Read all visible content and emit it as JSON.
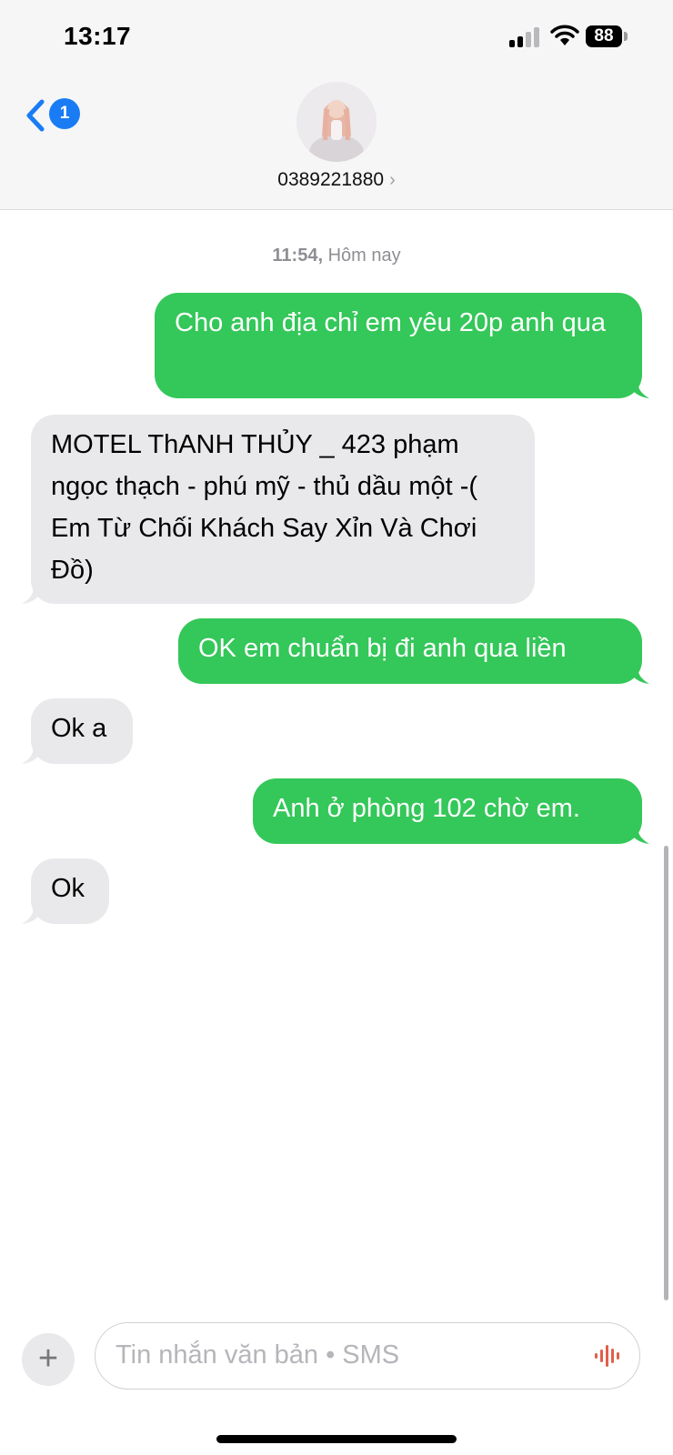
{
  "status_bar": {
    "time": "13:17",
    "battery": "88"
  },
  "header": {
    "back_badge": "1",
    "contact_name": "0389221880",
    "chevron": "›"
  },
  "thread": {
    "timestamp_time": "11:54,",
    "timestamp_day": "Hôm nay",
    "messages": [
      {
        "direction": "outgoing",
        "text": "Cho anh địa chỉ em yêu 20p anh qua"
      },
      {
        "direction": "incoming",
        "text": "MOTEL ThANH THỦY _ 423 phạm ngọc thạch - phú mỹ - thủ dầu một -( Em Từ Chối Khách Say Xỉn Và Chơi Đồ)"
      },
      {
        "direction": "outgoing",
        "text": "OK em chuẩn bị đi anh qua liền"
      },
      {
        "direction": "incoming",
        "text": "Ok a"
      },
      {
        "direction": "outgoing",
        "text": "Anh ở phòng 102 chờ em."
      },
      {
        "direction": "incoming",
        "text": "Ok"
      }
    ]
  },
  "composer": {
    "plus": "+",
    "placeholder": "Tin nhắn văn bản • SMS"
  },
  "colors": {
    "outgoing_bubble": "#34c759",
    "incoming_bubble": "#e9e9eb",
    "accent": "#1a7cf5"
  }
}
